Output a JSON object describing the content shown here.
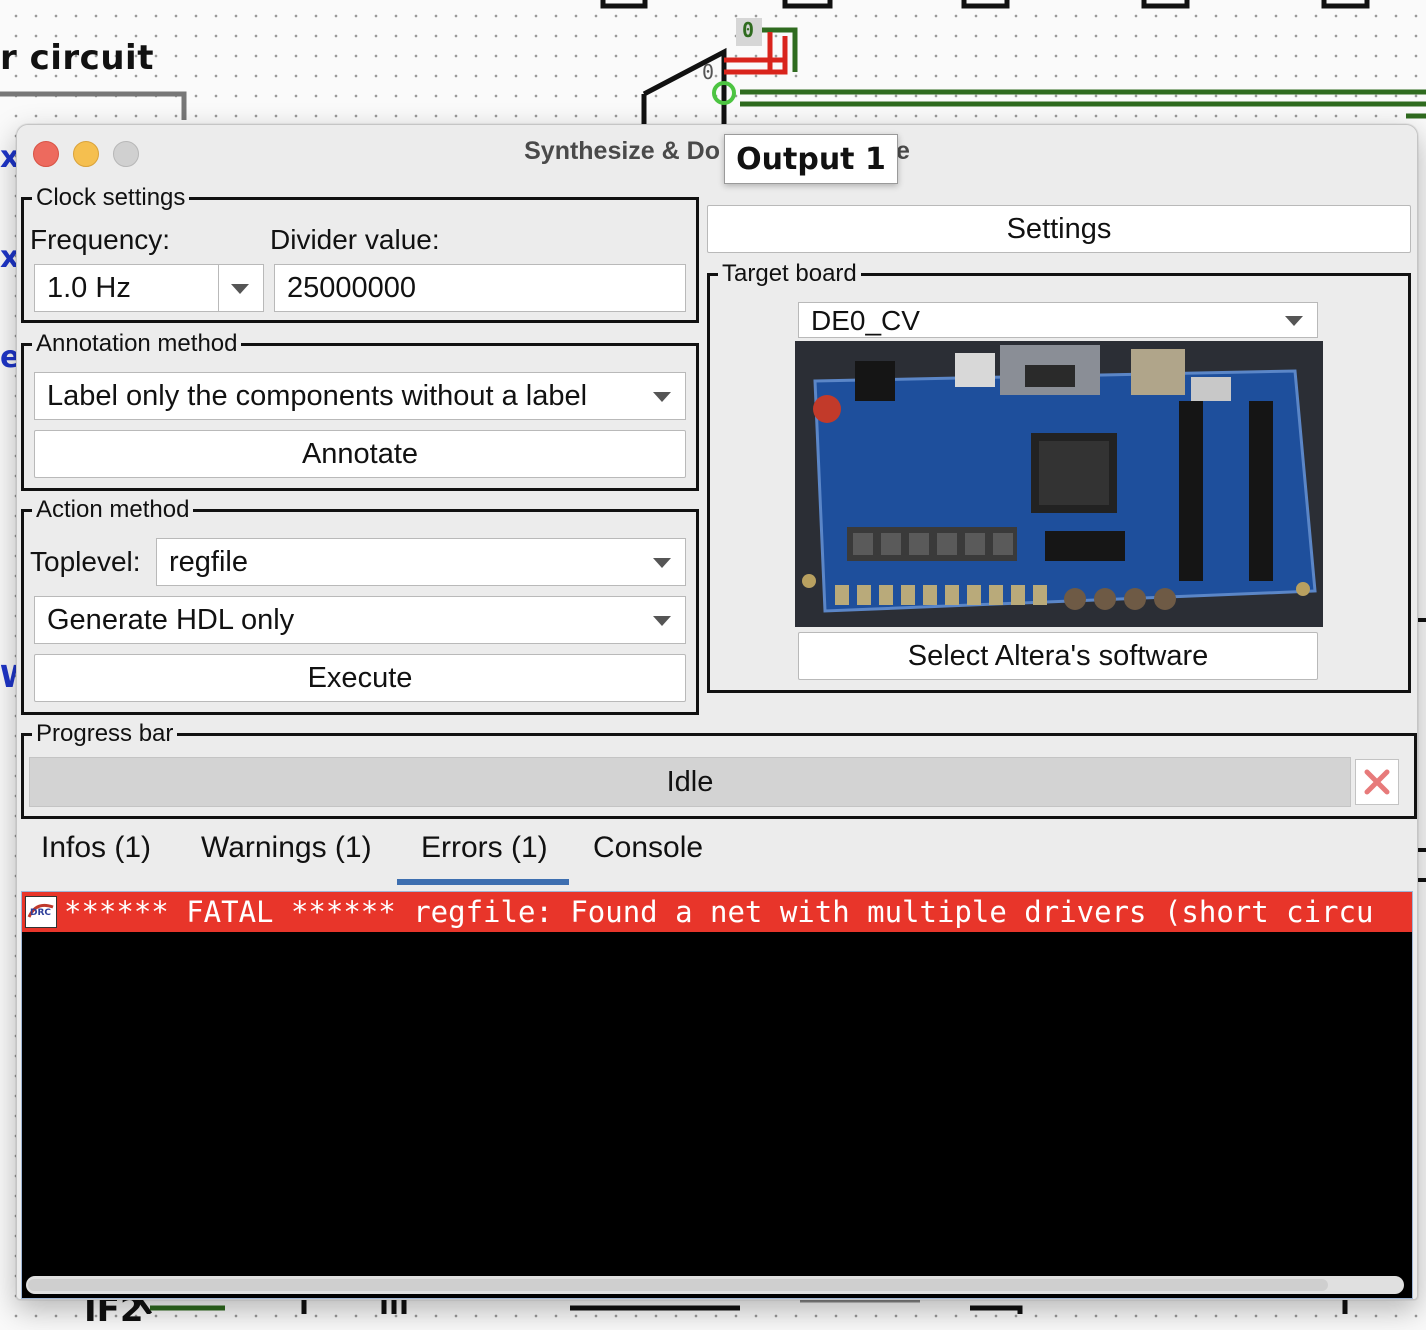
{
  "canvas": {
    "circuit_title": "r circuit",
    "probe_top": "0",
    "probe_left": "0",
    "bottom_label": "IF2",
    "side_labels": [
      "x",
      "x",
      "e",
      "W"
    ]
  },
  "tooltip": {
    "text": "Output 1"
  },
  "window": {
    "title_left": "Synthesize & Do",
    "title_right": "e"
  },
  "clock": {
    "legend": "Clock settings",
    "frequency_label": "Frequency:",
    "divider_label": "Divider value:",
    "frequency_value": "1.0 Hz",
    "divider_value": "25000000"
  },
  "annotation": {
    "legend": "Annotation method",
    "method_value": "Label only the components without a label",
    "annotate_button": "Annotate"
  },
  "action": {
    "legend": "Action method",
    "toplevel_label": "Toplevel:",
    "toplevel_value": "regfile",
    "mode_value": "Generate HDL only",
    "execute_button": "Execute"
  },
  "settings_button": "Settings",
  "target": {
    "legend": "Target board",
    "board_value": "DE0_CV",
    "software_button": "Select Altera's software"
  },
  "progress": {
    "legend": "Progress bar",
    "status": "Idle"
  },
  "tabs": [
    {
      "label": "Infos (1)"
    },
    {
      "label": "Warnings (1)"
    },
    {
      "label": "Errors (1)",
      "active": true
    },
    {
      "label": "Console"
    }
  ],
  "console": {
    "icon_text": "DRC",
    "error_line": "****** FATAL ****** regfile: Found a net with multiple drivers (short circu"
  },
  "colors": {
    "error_bg": "#e8352a",
    "active_tab": "#3e6fb0",
    "wire_green": "#2f6b1f",
    "probe_red": "#d9241c"
  }
}
